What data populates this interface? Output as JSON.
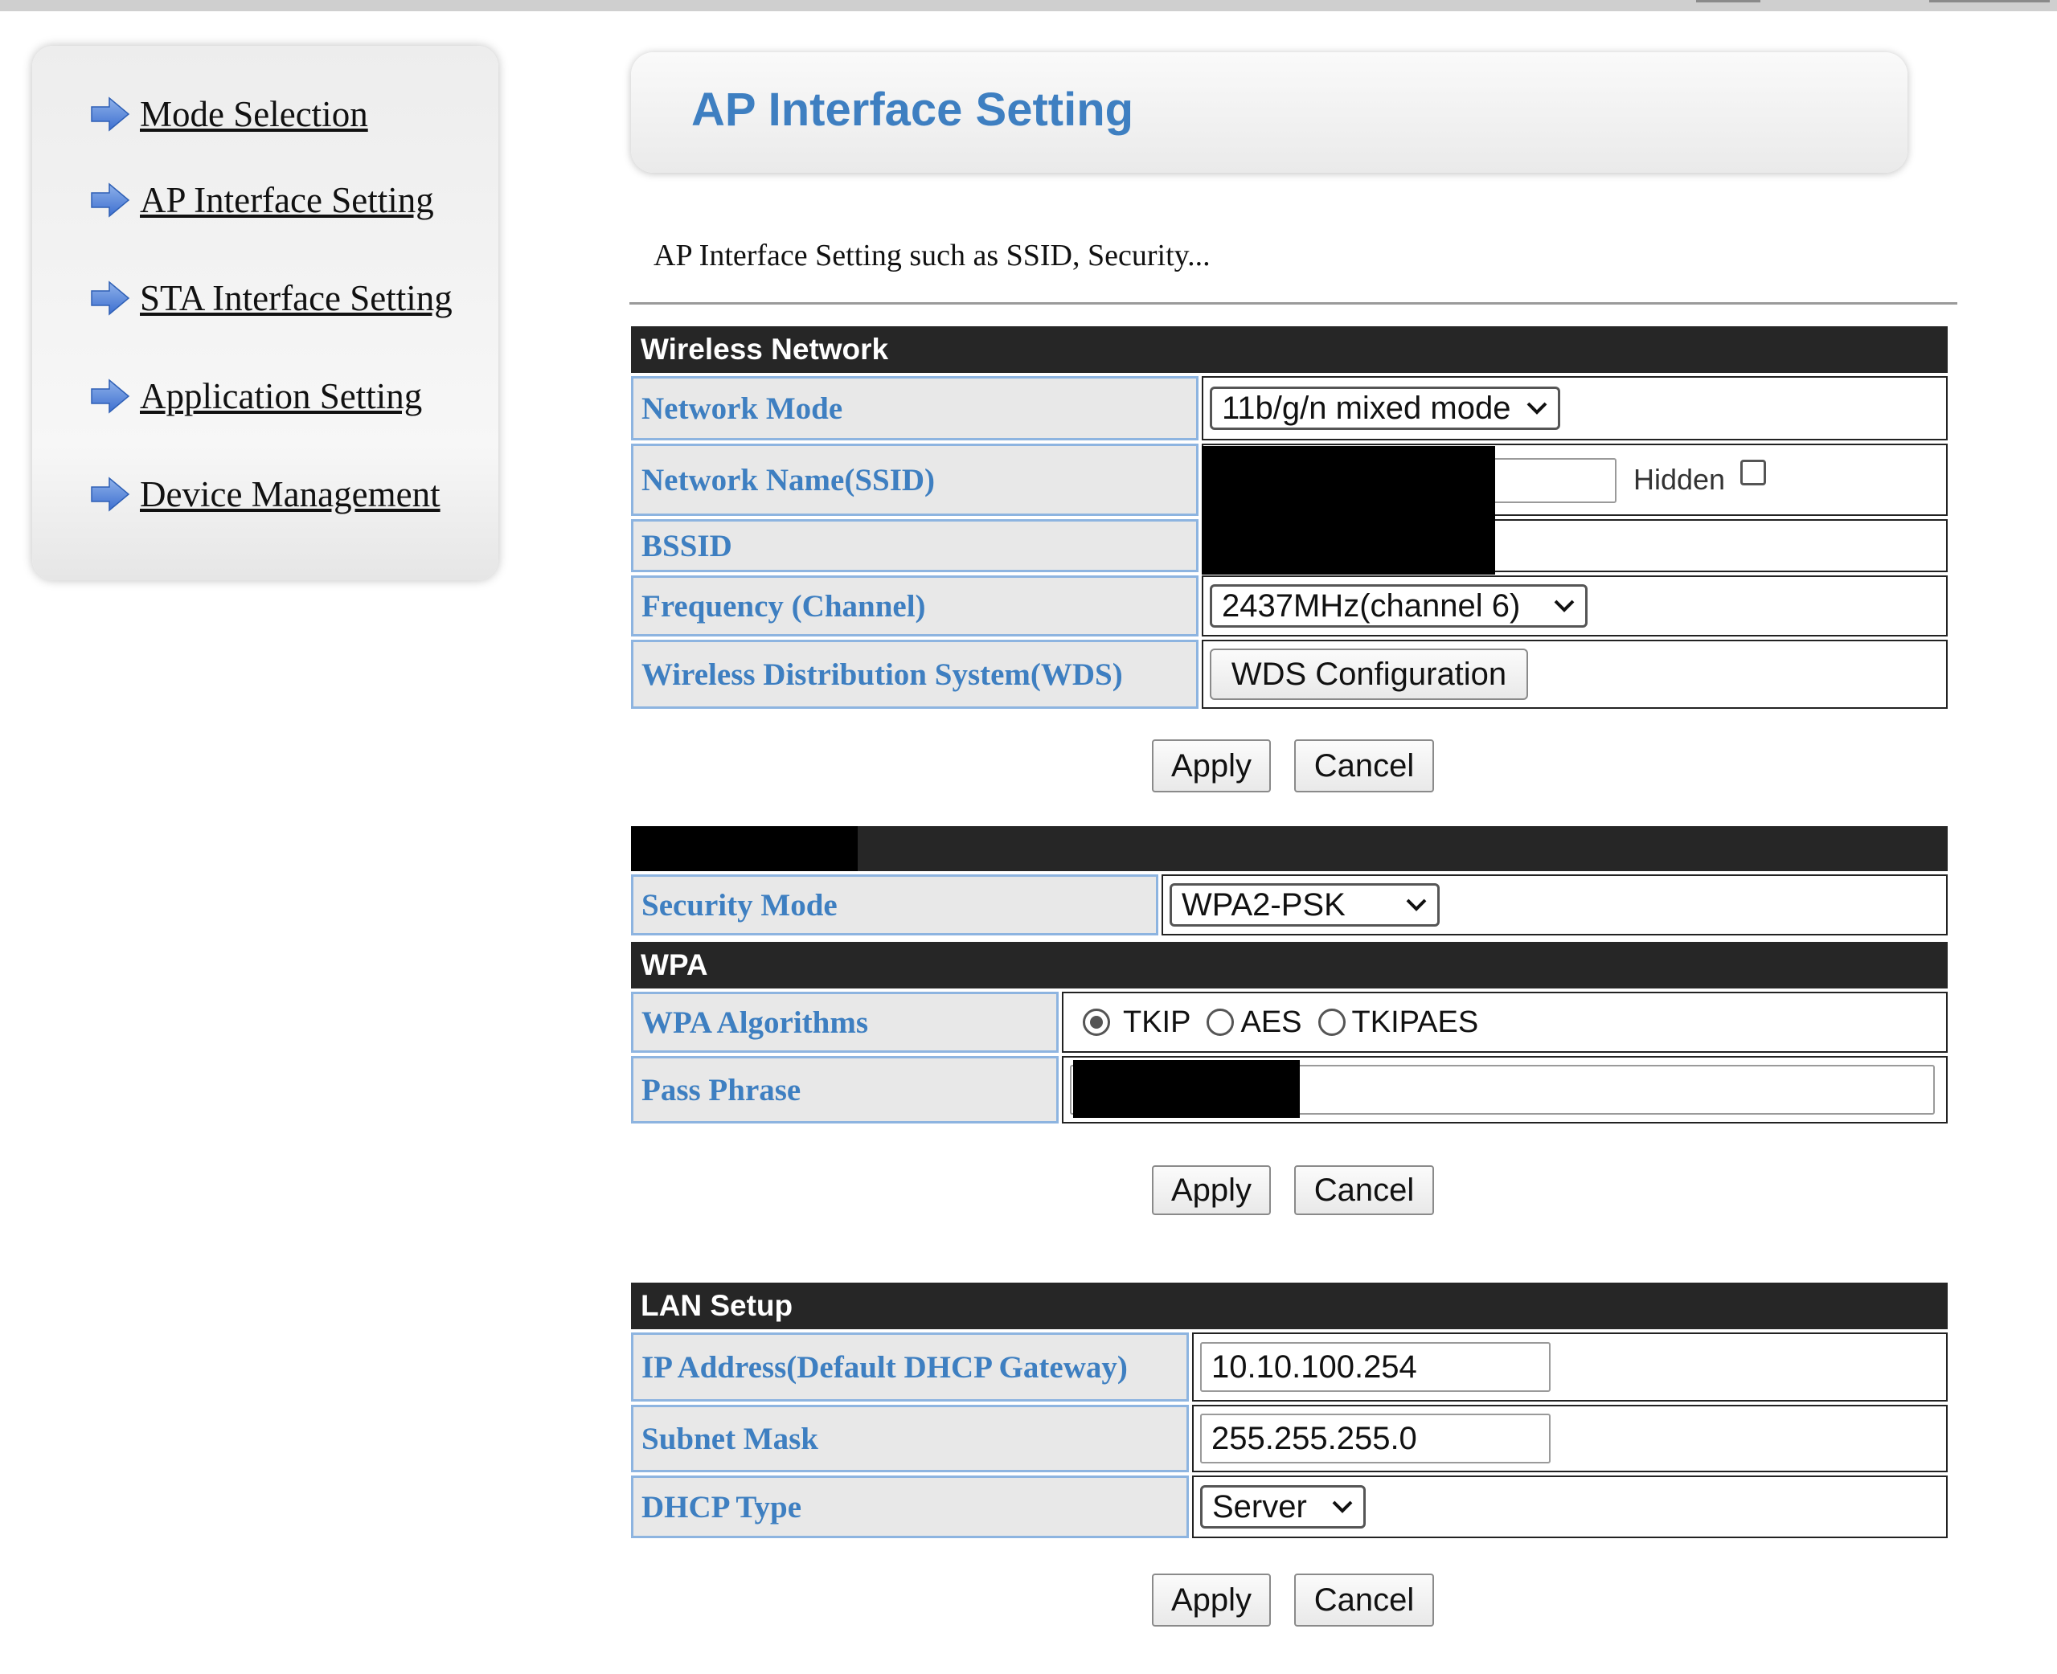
{
  "sidebar": {
    "items": [
      {
        "label": "Mode Selection"
      },
      {
        "label": "AP Interface Setting"
      },
      {
        "label": "STA Interface Setting"
      },
      {
        "label": "Application Setting"
      },
      {
        "label": "Device Management"
      }
    ]
  },
  "header": {
    "title": "AP Interface Setting",
    "subtitle": "AP Interface Setting such as SSID, Security..."
  },
  "wireless": {
    "section_title": "Wireless Network",
    "network_mode_label": "Network Mode",
    "network_mode_value": "11b/g/n mixed mode",
    "ssid_label": "Network Name(SSID)",
    "hidden_label": "Hidden",
    "bssid_label": "BSSID",
    "frequency_label": "Frequency (Channel)",
    "frequency_value": "2437MHz(channel 6)",
    "wds_label": "Wireless Distribution System(WDS)",
    "wds_button": "WDS Configuration"
  },
  "security": {
    "security_mode_label": "Security Mode",
    "security_mode_value": "WPA2-PSK",
    "wpa_section_title": "WPA",
    "algorithms_label": "WPA Algorithms",
    "algorithms": [
      {
        "label": "TKIP",
        "checked": true
      },
      {
        "label": "AES",
        "checked": false
      },
      {
        "label": "TKIPAES",
        "checked": false
      }
    ],
    "pass_phrase_label": "Pass Phrase"
  },
  "lan": {
    "section_title": "LAN Setup",
    "ip_label": "IP Address(Default DHCP Gateway)",
    "ip_value": "10.10.100.254",
    "subnet_label": "Subnet Mask",
    "subnet_value": "255.255.255.0",
    "dhcp_label": "DHCP Type",
    "dhcp_value": "Server"
  },
  "buttons": {
    "apply": "Apply",
    "cancel": "Cancel"
  },
  "colors": {
    "label_text": "#3e7fc1",
    "label_border": "#8db4e0",
    "section_header": "#262626"
  }
}
